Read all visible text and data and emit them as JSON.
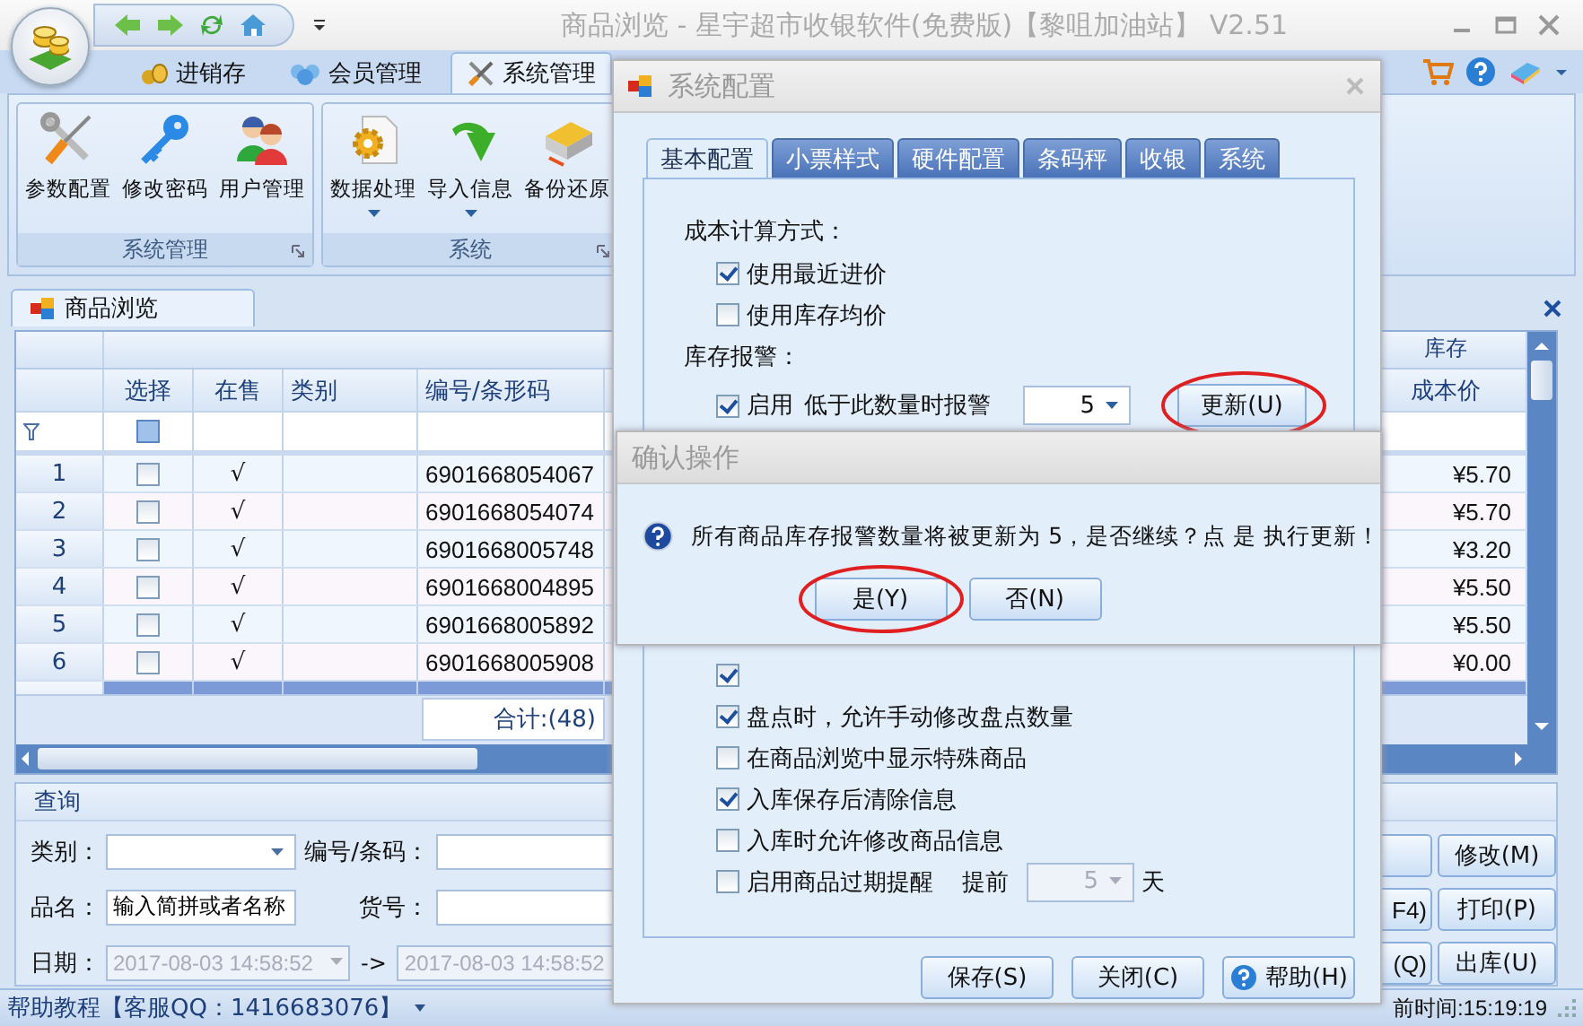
{
  "window": {
    "title": "商品浏览 - 星宇超市收银软件(免费版)【黎咀加油站】 V2.51"
  },
  "ribbon": {
    "tabs": [
      {
        "label": "进销存",
        "selected": false,
        "kind": "coins"
      },
      {
        "label": "会员管理",
        "selected": false,
        "kind": "members"
      },
      {
        "label": "系统管理",
        "selected": true,
        "kind": "tools"
      }
    ],
    "groups": [
      {
        "title": "系统管理",
        "buttons": [
          {
            "label": "参数配置",
            "kind": "tools",
            "dropdown": false
          },
          {
            "label": "修改密码",
            "kind": "key",
            "dropdown": false
          },
          {
            "label": "用户管理",
            "kind": "users",
            "dropdown": false
          }
        ]
      },
      {
        "title": "系统",
        "buttons": [
          {
            "label": "数据处理",
            "kind": "gear",
            "dropdown": true
          },
          {
            "label": "导入信息",
            "kind": "import",
            "dropdown": true
          },
          {
            "label": "备份还原",
            "kind": "backup",
            "dropdown": false
          }
        ]
      }
    ]
  },
  "document_tab": {
    "label": "商品浏览"
  },
  "grid": {
    "group_header": "库存",
    "columns": [
      "选择",
      "在售",
      "类别",
      "编号/条形码",
      "成本价"
    ],
    "rows": [
      {
        "number": "1",
        "checked": false,
        "on_sale": "√",
        "code": "6901668054067",
        "cost": "¥5.70",
        "selected": false
      },
      {
        "number": "2",
        "checked": false,
        "on_sale": "√",
        "code": "6901668054074",
        "cost": "¥5.70",
        "selected": false
      },
      {
        "number": "3",
        "checked": false,
        "on_sale": "√",
        "code": "6901668005748",
        "cost": "¥3.20",
        "selected": false
      },
      {
        "number": "4",
        "checked": false,
        "on_sale": "√",
        "code": "6901668004895",
        "cost": "¥5.50",
        "selected": false
      },
      {
        "number": "5",
        "checked": false,
        "on_sale": "√",
        "code": "6901668005892",
        "cost": "¥5.50",
        "selected": false
      },
      {
        "number": "6",
        "checked": false,
        "on_sale": "√",
        "code": "6901668005908",
        "cost": "¥0.00",
        "selected": false
      },
      {
        "selected": true
      }
    ],
    "select_all": {
      "indeterminate": true
    },
    "total": "合计:(48)"
  },
  "query": {
    "title": "查询",
    "fields": [
      {
        "label": "类别：",
        "kind": "dropdown"
      },
      {
        "label": "编号/条码：",
        "kind": "text"
      },
      {
        "label": "品名：",
        "kind": "text",
        "value": "输入简拼或者名称"
      },
      {
        "label": "货号：",
        "kind": "text"
      }
    ],
    "date": {
      "label": "日期：",
      "from": "2017-08-03 14:58:52",
      "separator": "->",
      "to": "2017-08-03 14:58:52",
      "disabled": true
    },
    "buttons": [
      {
        "label": "F4)"
      },
      {
        "label": "(Q)"
      },
      {
        "label": "修改(M)"
      },
      {
        "label": "打印(P)"
      },
      {
        "label": "出库(U)"
      }
    ]
  },
  "status_bar": {
    "help": "帮助教程【客服QQ：1416683076】",
    "time": "前时间:15:19:19"
  },
  "config_dialog": {
    "title": "系统配置",
    "tabs": [
      {
        "label": "基本配置",
        "selected": true
      },
      {
        "label": "小票样式",
        "selected": false
      },
      {
        "label": "硬件配置",
        "selected": false
      },
      {
        "label": "条码秤",
        "selected": false
      },
      {
        "label": "收银",
        "selected": false
      },
      {
        "label": "系统",
        "selected": false
      }
    ],
    "cost_title": "成本计算方式：",
    "cost_options": [
      {
        "label": "使用最近进价",
        "checked": true
      },
      {
        "label": "使用库存均价",
        "checked": false
      }
    ],
    "alarm_title": "库存报警：",
    "alarm": {
      "label": "启用",
      "checked": true,
      "hint": "低于此数量时报警",
      "value": "5",
      "button": "更新(U)",
      "circled": true
    },
    "options": [
      {
        "checked": true
      },
      {
        "label": "盘点时，允许手动修改盘点数量",
        "checked": true
      },
      {
        "label": "在商品浏览中显示特殊商品",
        "checked": false
      },
      {
        "label": "入库保存后清除信息",
        "checked": true
      },
      {
        "label": "入库时允许修改商品信息",
        "checked": false
      }
    ],
    "expiry": {
      "label": "启用商品过期提醒",
      "checked": false,
      "before": "提前",
      "value": "5",
      "unit": "天",
      "disabled": true
    },
    "buttons": [
      {
        "label": "保存(S)",
        "kind": "plain"
      },
      {
        "label": "关闭(C)",
        "kind": "plain"
      },
      {
        "label": "帮助(H)",
        "kind": "help"
      }
    ]
  },
  "confirm_dialog": {
    "title": "确认操作",
    "message": "所有商品库存报警数量将被更新为 5，是否继续？点 是 执行更新！",
    "buttons": [
      {
        "label": "是(Y)",
        "circled": true
      },
      {
        "label": "否(N)",
        "circled": false
      }
    ]
  }
}
